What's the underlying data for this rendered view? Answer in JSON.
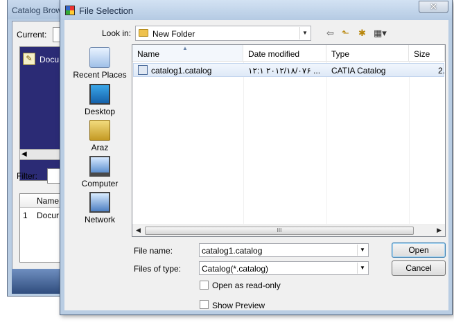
{
  "background_window": {
    "title": "Catalog Brow",
    "current_label": "Current:",
    "document_item": "Docu",
    "filter_label": "Filter:",
    "list_header": "Name",
    "list_row_index": "1",
    "list_row_text": "Docur"
  },
  "dialog": {
    "title": "File Selection",
    "close_symbol": "✕",
    "look_in_label": "Look in:",
    "look_in_value": "New Folder",
    "toolbar": {
      "back": "⇦",
      "up_folder": "⬑",
      "new_folder": "✱",
      "view_menu": "▦▾"
    },
    "places": [
      {
        "label": "Recent Places",
        "icon": "recent-places-icon"
      },
      {
        "label": "Desktop",
        "icon": "desktop-icon"
      },
      {
        "label": "Araz",
        "icon": "user-folder-icon"
      },
      {
        "label": "Computer",
        "icon": "computer-icon"
      },
      {
        "label": "Network",
        "icon": "network-icon"
      }
    ],
    "columns": [
      "Name",
      "Date modified",
      "Type",
      "Size"
    ],
    "files": [
      {
        "name": "catalog1.catalog",
        "date": "٢٠١٢/١٨/٠٧ ١٢:١۶ ...",
        "type": "CATIA Catalog",
        "size": "2."
      }
    ],
    "scroll_grip": "III",
    "file_name_label": "File name:",
    "file_name_value": "catalog1.catalog",
    "files_of_type_label": "Files of type:",
    "files_of_type_value": "Catalog(*.catalog)",
    "open_button": "Open",
    "cancel_button": "Cancel",
    "open_readonly_label": "Open as read-only",
    "show_preview_label": "Show Preview"
  }
}
